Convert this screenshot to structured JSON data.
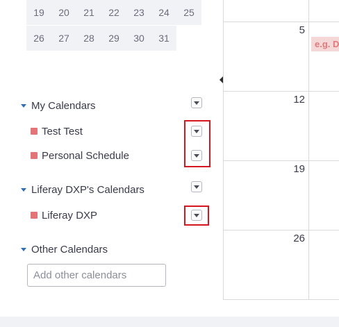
{
  "mini_calendar": {
    "rows": [
      [
        "19",
        "20",
        "21",
        "22",
        "23",
        "24",
        "25"
      ],
      [
        "26",
        "27",
        "28",
        "29",
        "30",
        "31"
      ]
    ]
  },
  "month_grid": {
    "day_numbers": [
      "5",
      "12",
      "19",
      "26"
    ],
    "event_placeholder": "e.g. D"
  },
  "sidebar": {
    "my_calendars": {
      "title": "My Calendars",
      "items": [
        {
          "name": "Test Test",
          "color": "#e37578"
        },
        {
          "name": "Personal Schedule",
          "color": "#e37578"
        }
      ]
    },
    "site_calendars": {
      "title": "Liferay DXP's Calendars",
      "items": [
        {
          "name": "Liferay DXP",
          "color": "#e37578"
        }
      ]
    },
    "other_calendars": {
      "title": "Other Calendars",
      "input_placeholder": "Add other calendars"
    }
  },
  "colors": {
    "accent": "#2e6fb8",
    "highlight": "#d7171f",
    "calendar_swatch": "#e37578"
  }
}
